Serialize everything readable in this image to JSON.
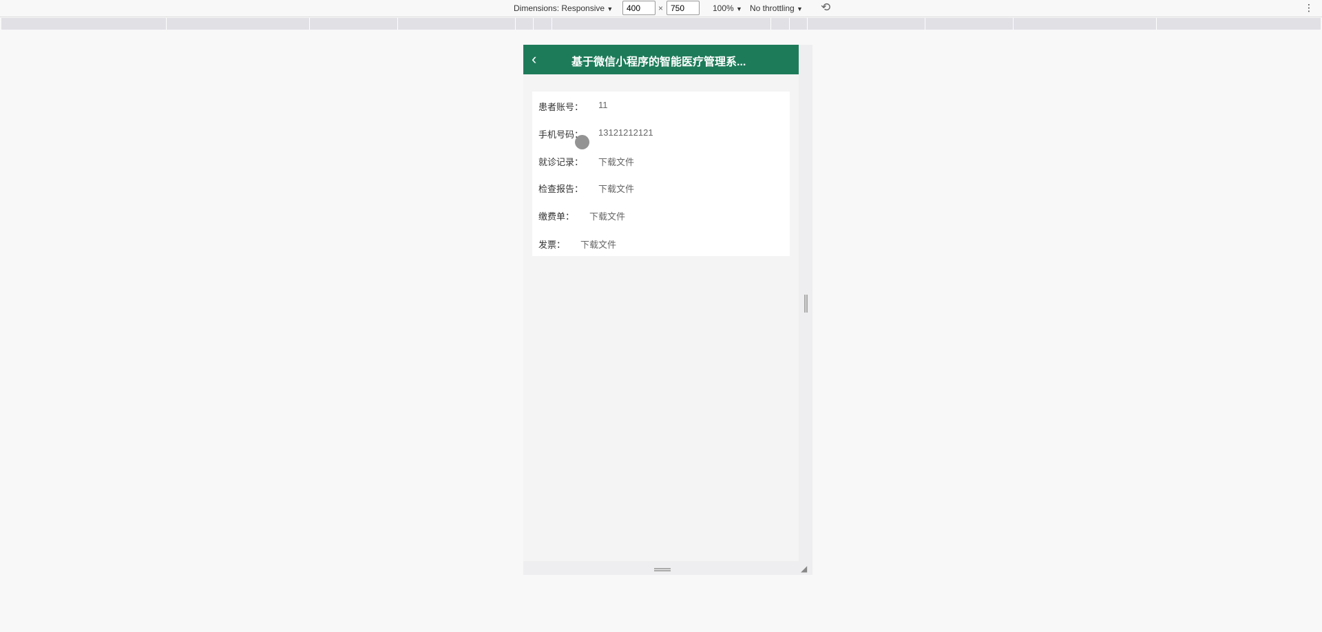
{
  "devtools": {
    "dimensions_label": "Dimensions: Responsive",
    "width": "400",
    "height": "750",
    "times": "×",
    "zoom": "100%",
    "throttling": "No throttling",
    "caret": "▼",
    "more": "⋮"
  },
  "app": {
    "title": "基于微信小程序的智能医疗管理系...",
    "header_color": "#1e7b5a",
    "back": "‹",
    "fields": [
      {
        "label": "患者账号：",
        "value": "11"
      },
      {
        "label": "手机号码：",
        "value": "13121212121"
      },
      {
        "label": "就诊记录：",
        "value": "下载文件"
      },
      {
        "label": "检查报告：",
        "value": "下载文件"
      },
      {
        "label": "缴费单：",
        "value": "下载文件"
      },
      {
        "label": "发票：",
        "value": "下载文件"
      }
    ]
  }
}
